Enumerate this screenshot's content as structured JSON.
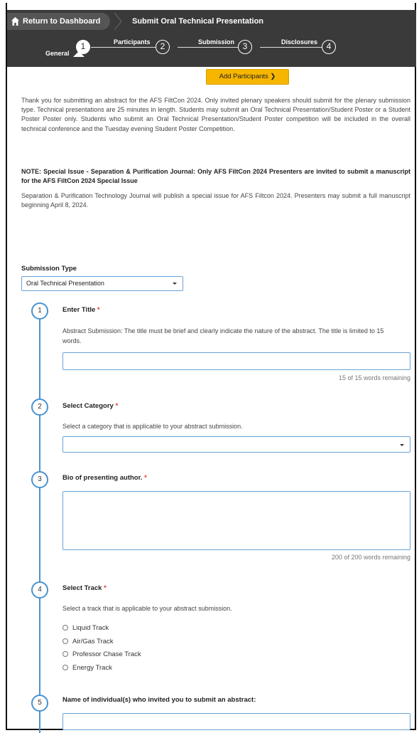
{
  "header": {
    "home_label": "Return to Dashboard",
    "current_label": "Submit Oral Technical Presentation"
  },
  "steps": [
    {
      "label": "General",
      "number": "1",
      "active": true
    },
    {
      "label": "Participants",
      "number": "2",
      "active": false
    },
    {
      "label": "Submission",
      "number": "3",
      "active": false
    },
    {
      "label": "Disclosures",
      "number": "4",
      "active": false
    }
  ],
  "add_participants_label": "Add Participants ❯",
  "intro_text": "Thank you for submitting an abstract for the AFS FiltCon 2024. Only invited plenary speakers should submit for the plenary submission type. Technical presentations are 25 minutes in length. Students may submit an Oral Technical Presentation/Student Poster or a Student Poster Poster only. Students who submit an Oral Technical Presentation/Student Poster competition will be included in the overall technical conference and the Tuesday evening Student Poster Competition.",
  "note_text": "NOTE:  Special Issue - Separation & Purification Journal:  Only AFS FiltCon 2024 Presenters are invited to submit a manuscript for the AFS FiltCon 2024 Special Issue",
  "note2_text": "Separation & Purification Technology Journal will publish a special issue for AFS Filtcon 2024. Presenters may submit a full manuscript beginning April 8, 2024.",
  "submission_type": {
    "label": "Submission Type",
    "value": "Oral Technical Presentation"
  },
  "questions": {
    "q1": {
      "number": "1",
      "title": "Enter Title",
      "required": "*",
      "help": "Abstract Submission: The title must be brief and clearly indicate the nature of the abstract. The title is limited to 15 words.",
      "value": "",
      "count": "15 of 15 words remaining"
    },
    "q2": {
      "number": "2",
      "title": "Select Category",
      "required": "*",
      "help": "Select a category that is applicable to your abstract submission.",
      "value": ""
    },
    "q3": {
      "number": "3",
      "title": "Bio of presenting author.",
      "required": "*",
      "value": "",
      "count": "200 of 200 words remaining"
    },
    "q4": {
      "number": "4",
      "title": "Select Track",
      "required": "*",
      "help": "Select a track that is applicable to your abstract submission.",
      "options": [
        "Liquid Track",
        "Air/Gas Track",
        "Professor Chase Track",
        "Energy Track"
      ]
    },
    "q5": {
      "number": "5",
      "title": "Name of individual(s) who invited you to submit an abstract:",
      "value": ""
    }
  },
  "colors": {
    "header_bg": "#3a3a3a",
    "accent": "#4a92cf",
    "button": "#f6b600",
    "required": "#e23b3b"
  }
}
